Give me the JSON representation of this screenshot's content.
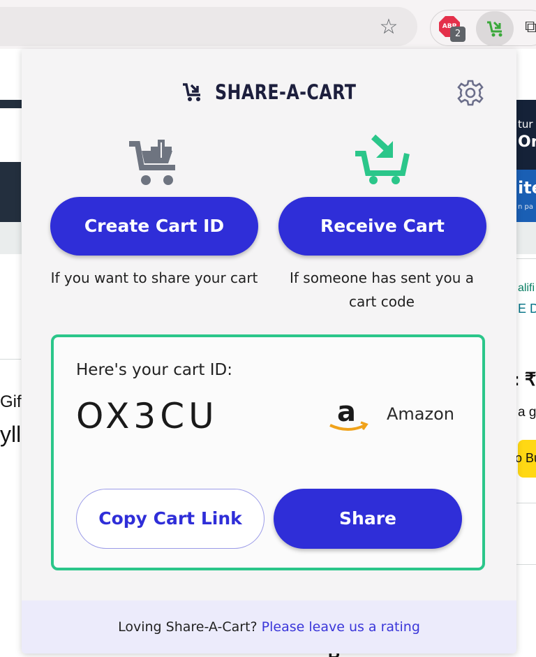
{
  "browser": {
    "star_icon": "star-icon",
    "abp_label": "ABP",
    "abp_count": "2",
    "extension_icon": "share-a-cart-icon"
  },
  "background_page": {
    "right_top_line1": "tur",
    "right_top_line2": "On",
    "right_banner_text": "ite",
    "right_banner_sub": "n pa",
    "left_text1": "Gif",
    "left_text2": "yll",
    "right_text1": "alifi",
    "right_text2": "E De",
    "right_text3": ": ₹",
    "right_text4": "a g",
    "right_text5": "o Bu",
    "bottom_text": "R"
  },
  "popup": {
    "brand": "SHARE-A-CART",
    "settings_icon": "gear-icon",
    "create_button": "Create Cart ID",
    "create_hint": "If you want to share your cart",
    "receive_button": "Receive Cart",
    "receive_hint": "If someone has sent you a cart code",
    "cart_label": "Here's your cart ID:",
    "cart_id": "OX3CU",
    "store_name": "Amazon",
    "copy_button": "Copy Cart Link",
    "share_button": "Share",
    "footer_text": "Loving Share-A-Cart?",
    "footer_link": "Please leave us a rating"
  },
  "colors": {
    "primary": "#2f2ed8",
    "accent_green": "#2bc68a",
    "footer_bg": "#ecebfb",
    "brand_dark": "#1d1f3d"
  }
}
